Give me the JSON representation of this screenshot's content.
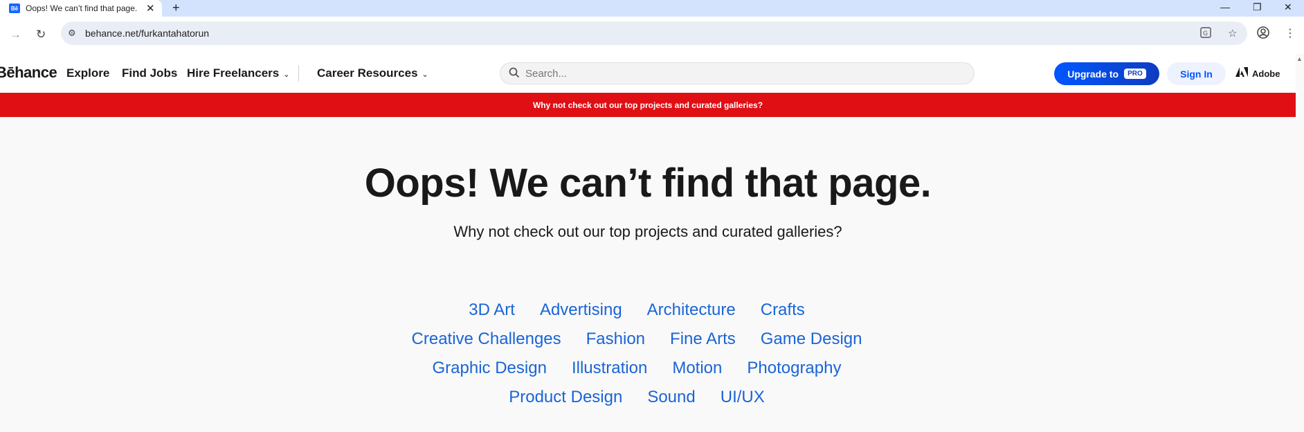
{
  "browser": {
    "tab_favicon": "Bē",
    "tab_title": "Oops! We can’t find that page.",
    "tab_close": "✕",
    "new_tab": "+",
    "url": "behance.net/furkantahatorun",
    "window_controls": {
      "minimize": "—",
      "restore": "❐",
      "close": "✕"
    }
  },
  "header": {
    "logo": "Bēhance",
    "nav": {
      "explore": "Explore",
      "find_jobs": "Find Jobs",
      "hire_freelancers": "Hire Freelancers",
      "career_resources": "Career Resources"
    },
    "search_placeholder": "Search...",
    "upgrade_label": "Upgrade to",
    "pro_badge": "PRO",
    "sign_in": "Sign In",
    "adobe": "Adobe"
  },
  "banner": {
    "text": "Why not check out our top projects and curated galleries?"
  },
  "main": {
    "headline": "Oops! We can’t find that page.",
    "subline": "Why not check out our top projects and curated galleries?",
    "category_rows": [
      [
        "3D Art",
        "Advertising",
        "Architecture",
        "Crafts"
      ],
      [
        "Creative Challenges",
        "Fashion",
        "Fine Arts",
        "Game Design"
      ],
      [
        "Graphic Design",
        "Illustration",
        "Motion",
        "Photography"
      ],
      [
        "Product Design",
        "Sound",
        "UI/UX"
      ]
    ]
  },
  "colors": {
    "banner": "#e00f14",
    "link": "#1a64d6",
    "primary": "#0057ff",
    "tabbar": "#d3e3fd"
  },
  "icons": [
    "reload-icon",
    "forward-icon",
    "site-info-icon",
    "translate-icon",
    "bookmark-star-icon",
    "profile-icon",
    "menu-icon",
    "search-icon",
    "chevron-down-icon"
  ]
}
